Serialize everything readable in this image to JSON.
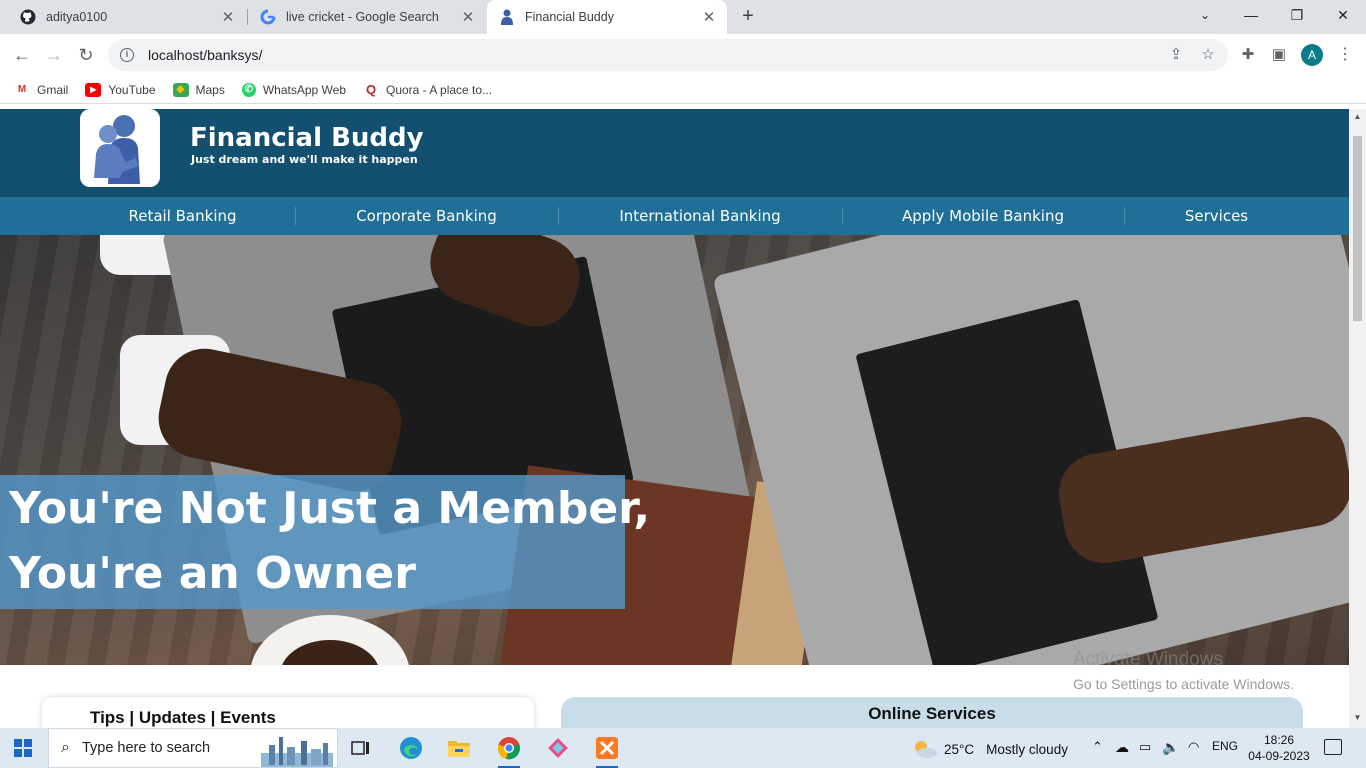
{
  "browser": {
    "tabs": [
      {
        "title": "aditya0100",
        "icon": "github-icon"
      },
      {
        "title": "live cricket - Google Search",
        "icon": "google-icon"
      },
      {
        "title": "Financial Buddy",
        "icon": "site-logo-icon",
        "active": true
      }
    ],
    "url": "localhost/banksys/",
    "avatar_letter": "A",
    "bookmarks": [
      {
        "label": "Gmail",
        "icon": "gmail-icon",
        "color": "#d93025"
      },
      {
        "label": "YouTube",
        "icon": "youtube-icon",
        "color": "#ff0000"
      },
      {
        "label": "Maps",
        "icon": "maps-icon",
        "color": "#34a853"
      },
      {
        "label": "WhatsApp Web",
        "icon": "whatsapp-icon",
        "color": "#25d366"
      },
      {
        "label": "Quora - A place to...",
        "icon": "quora-icon",
        "color": "#b92b27"
      }
    ]
  },
  "site": {
    "brand": "Financial Buddy",
    "tagline": "Just dream and we'll make it happen",
    "nav": [
      {
        "label": "Retail Banking"
      },
      {
        "label": "Corporate Banking"
      },
      {
        "label": "International Banking"
      },
      {
        "label": "Apply Mobile Banking"
      },
      {
        "label": "Services"
      }
    ],
    "hero": {
      "line1": "You're Not Just a Member,",
      "line2": "You're an Owner"
    },
    "tips_heading": "Tips | Updates | Events",
    "online_heading": "Online Services",
    "colors": {
      "header": "#134f6f",
      "nav": "#1f6f96",
      "banner": "#5696c8"
    }
  },
  "watermark": {
    "line1": "Activate Windows",
    "line2": "Go to Settings to activate Windows."
  },
  "taskbar": {
    "search_placeholder": "Type here to search",
    "weather_temp": "25°C",
    "weather_desc": "Mostly cloudy",
    "language": "ENG",
    "time": "18:26",
    "date": "04-09-2023"
  }
}
